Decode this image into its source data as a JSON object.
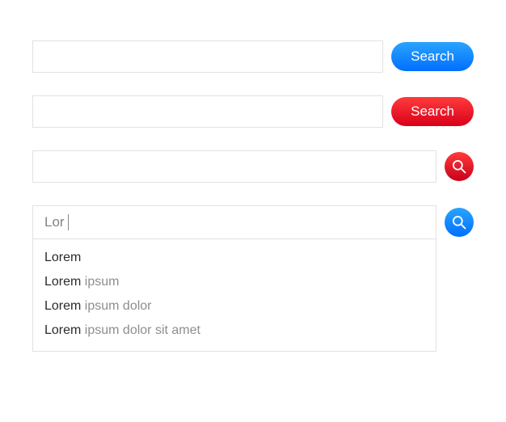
{
  "bars": {
    "bar1": {
      "button_label": "Search"
    },
    "bar2": {
      "button_label": "Search"
    }
  },
  "autocomplete": {
    "typed": "Lor",
    "suggestions": [
      {
        "strong": "Lorem",
        "weak": ""
      },
      {
        "strong": "Lorem",
        "weak": " ipsum"
      },
      {
        "strong": "Lorem",
        "weak": " ipsum dolor"
      },
      {
        "strong": "Lorem",
        "weak": " ipsum dolor sit amet"
      }
    ]
  },
  "colors": {
    "blue_accent": "#1e90ff",
    "red_accent": "#e3001b",
    "border": "#e2e2e2"
  }
}
